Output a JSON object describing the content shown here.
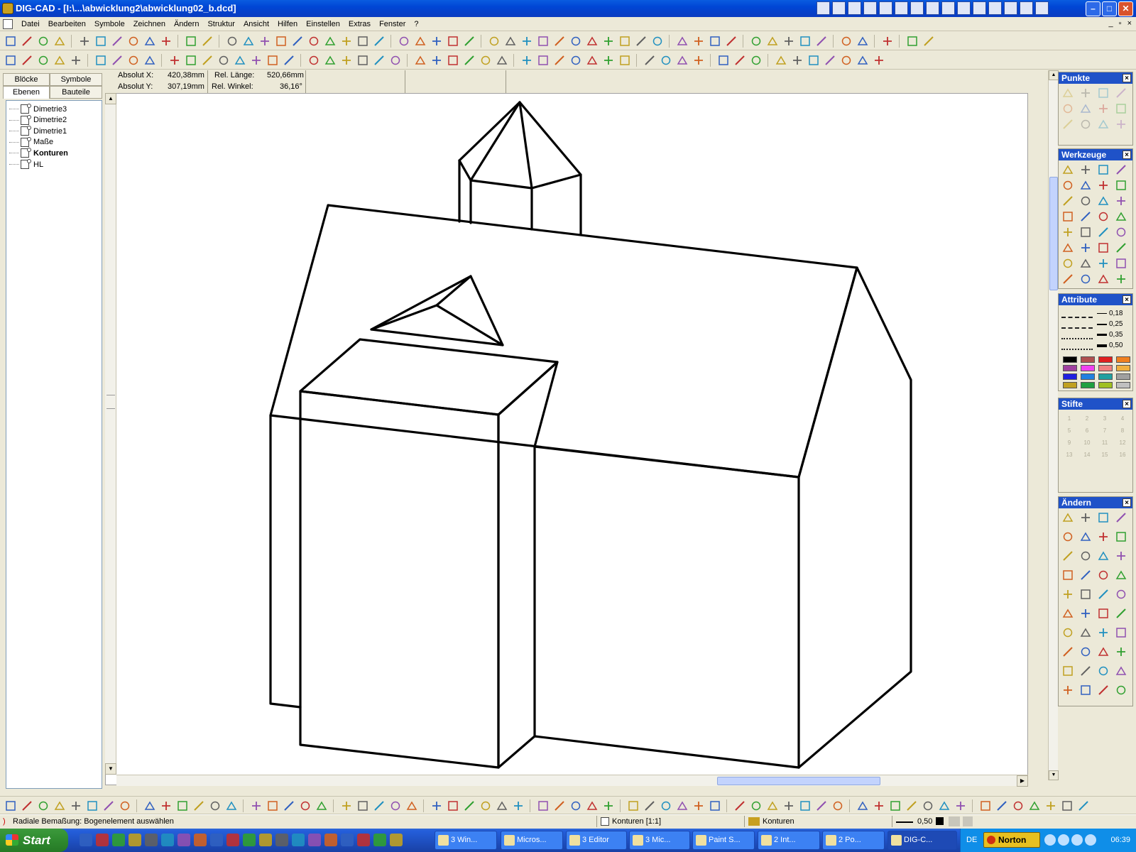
{
  "window": {
    "title": "DIG-CAD - [I:\\...\\abwicklung2\\abwicklung02_b.dcd]",
    "minimize_icon": "minimize-icon",
    "maximize_icon": "maximize-icon",
    "close_icon": "close-icon"
  },
  "menubar": {
    "items": [
      "Datei",
      "Bearbeiten",
      "Symbole",
      "Zeichnen",
      "Ändern",
      "Struktur",
      "Ansicht",
      "Hilfen",
      "Einstellen",
      "Extras",
      "Fenster",
      "?"
    ],
    "mdi_minimize": "_",
    "mdi_restore": "▫",
    "mdi_close": "×"
  },
  "left_panel": {
    "tabs": [
      "Blöcke",
      "Symbole",
      "Ebenen",
      "Bauteile"
    ],
    "active_tab": "Ebenen",
    "layers": [
      {
        "label": "Dimetrie3",
        "active": false
      },
      {
        "label": "Dimetrie2",
        "active": false
      },
      {
        "label": "Dimetrie1",
        "active": false
      },
      {
        "label": "Maße",
        "active": false
      },
      {
        "label": "Konturen",
        "active": true
      },
      {
        "label": "HL",
        "active": false
      }
    ]
  },
  "coords": {
    "abs_x_label": "Absolut X:",
    "abs_x_value": "420,38mm",
    "abs_y_label": "Absolut Y:",
    "abs_y_value": "307,19mm",
    "rel_len_label": "Rel. Länge:",
    "rel_len_value": "520,66mm",
    "rel_angle_label": "Rel. Winkel:",
    "rel_angle_value": "36,16°"
  },
  "panels": {
    "punkte": {
      "title": "Punkte",
      "close": "×"
    },
    "werkzeuge": {
      "title": "Werkzeuge",
      "close": "×"
    },
    "attribute": {
      "title": "Attribute",
      "close": "×",
      "line_widths": [
        "0,18",
        "0,25",
        "0,35",
        "0,50"
      ],
      "colors": [
        "#000000",
        "#b05050",
        "#e02020",
        "#f08020",
        "#a040a0",
        "#f040f0",
        "#f08080",
        "#f0b040",
        "#2020e0",
        "#2080e0",
        "#20a0a0",
        "#a0a0a0",
        "#c0a020",
        "#20a040",
        "#a0c020",
        "#c0c0c0"
      ]
    },
    "stifte": {
      "title": "Stifte",
      "close": "×",
      "pens": [
        "1",
        "2",
        "3",
        "4",
        "5",
        "6",
        "7",
        "8",
        "9",
        "10",
        "11",
        "12",
        "13",
        "14",
        "15",
        "16"
      ]
    },
    "aendern": {
      "title": "Ändern",
      "close": "×"
    }
  },
  "statusbar": {
    "message": "Radiale Bemaßung: Bogenelement auswählen",
    "layer_scale": "Konturen [1:1]",
    "layer_name": "Konturen",
    "pen_width": "0,50"
  },
  "taskbar": {
    "start_label": "Start",
    "buttons": [
      "3 Win...",
      "Micros...",
      "3 Editor",
      "3 Mic...",
      "Paint S...",
      "2 Int...",
      "2 Po...",
      "DIG-C..."
    ],
    "active_button": "DIG-C...",
    "language": "DE",
    "norton": "Norton",
    "clock": "06:39"
  }
}
